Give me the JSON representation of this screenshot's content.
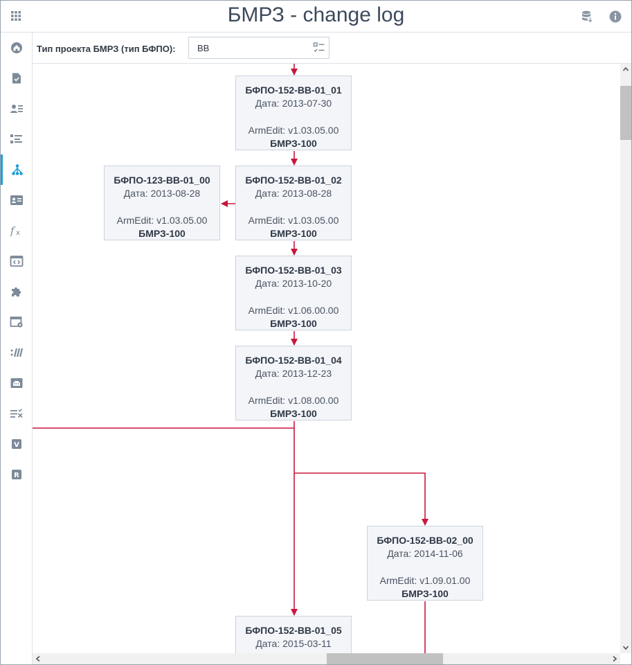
{
  "app": {
    "title": "БМРЗ - change log"
  },
  "header": {
    "icons": [
      "apps-grid-icon",
      "database-icon",
      "info-icon"
    ]
  },
  "sidebar": {
    "active_index": 4,
    "items": [
      {
        "icon": "home-icon"
      },
      {
        "icon": "document-check-icon"
      },
      {
        "icon": "users-list-icon"
      },
      {
        "icon": "task-list-icon"
      },
      {
        "icon": "branch-tree-icon"
      },
      {
        "icon": "id-card-icon"
      },
      {
        "icon": "function-fx-icon"
      },
      {
        "icon": "code-window-icon"
      },
      {
        "icon": "puzzle-icon"
      },
      {
        "icon": "window-settings-icon"
      },
      {
        "icon": "slashes-icon"
      },
      {
        "icon": "ethernet-port-icon"
      },
      {
        "icon": "list-clear-icon"
      },
      {
        "icon": "v-badge-icon",
        "letter": "V"
      },
      {
        "icon": "r-badge-icon",
        "letter": "R"
      }
    ]
  },
  "filter": {
    "label": "Тип проекта БМРЗ (тип БФПО):",
    "value": "ВВ"
  },
  "graph": {
    "colors": {
      "edge": "#c8163d",
      "node_bg": "#f3f5f9",
      "node_border": "#ccd3dc"
    },
    "nodes": [
      {
        "id": "n0101",
        "title": "БФПО-152-ВВ-01_01",
        "date": "Дата: 2013-07-30",
        "version": "ArmEdit: v1.03.05.00",
        "model": "БМРЗ-100"
      },
      {
        "id": "n0102",
        "title": "БФПО-152-ВВ-01_02",
        "date": "Дата: 2013-08-28",
        "version": "ArmEdit: v1.03.05.00",
        "model": "БМРЗ-100"
      },
      {
        "id": "n12300",
        "title": "БФПО-123-ВВ-01_00",
        "date": "Дата: 2013-08-28",
        "version": "ArmEdit: v1.03.05.00",
        "model": "БМРЗ-100"
      },
      {
        "id": "n0103",
        "title": "БФПО-152-ВВ-01_03",
        "date": "Дата: 2013-10-20",
        "version": "ArmEdit: v1.06.00.00",
        "model": "БМРЗ-100"
      },
      {
        "id": "n0104",
        "title": "БФПО-152-ВВ-01_04",
        "date": "Дата: 2013-12-23",
        "version": "ArmEdit: v1.08.00.00",
        "model": "БМРЗ-100"
      },
      {
        "id": "n0200",
        "title": "БФПО-152-ВВ-02_00",
        "date": "Дата: 2014-11-06",
        "version": "ArmEdit: v1.09.01.00",
        "model": "БМРЗ-100"
      },
      {
        "id": "n0105",
        "title": "БФПО-152-ВВ-01_05",
        "date": "Дата: 2015-03-11",
        "version": "",
        "model": ""
      }
    ]
  }
}
